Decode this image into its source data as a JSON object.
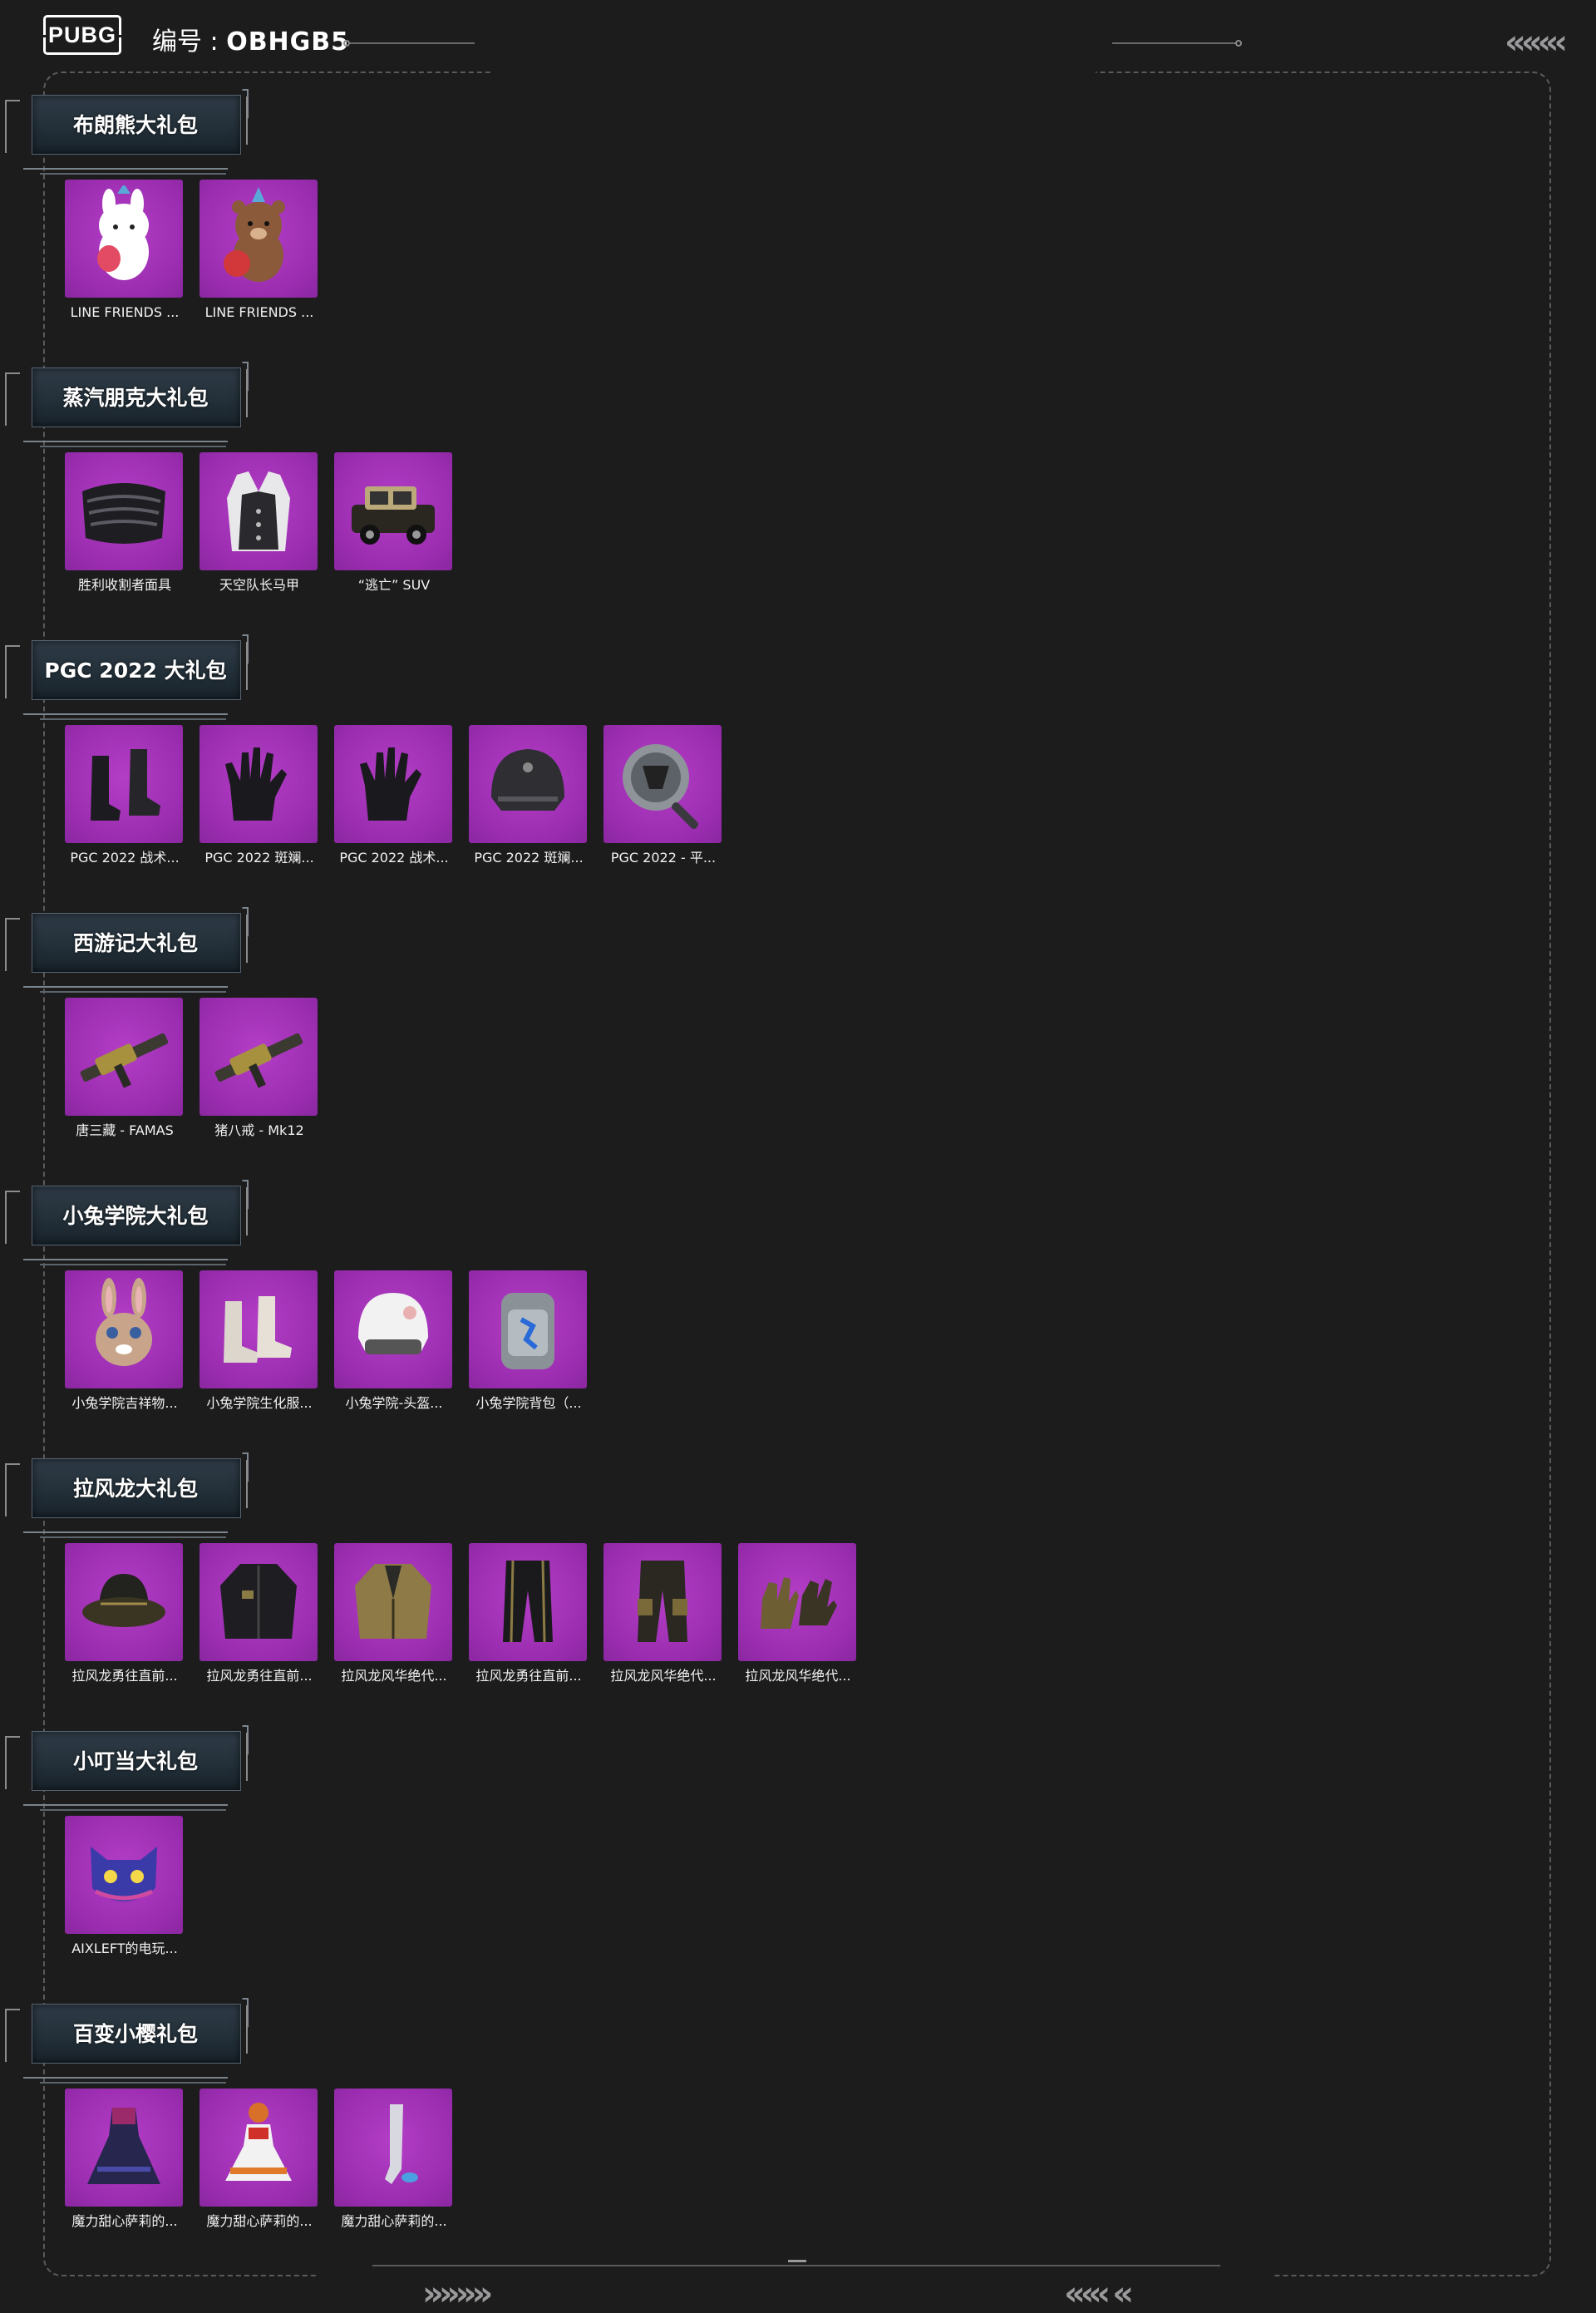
{
  "header": {
    "logo_text": "PUBG",
    "serial_label": "编号 : ",
    "serial_value": "OBHGB5"
  },
  "decor": {
    "top_right_chevrons": "«««‹",
    "bottom_left_chevrons": "»»»»",
    "bottom_right_chevrons": "««‹ «"
  },
  "sections": [
    {
      "title": "布朗熊大礼包",
      "items": [
        {
          "caption": "LINE FRIENDS ...",
          "icon": "cony-bunny-icon"
        },
        {
          "caption": "LINE FRIENDS ...",
          "icon": "brown-bear-icon"
        }
      ]
    },
    {
      "title": "蒸汽朋克大礼包",
      "items": [
        {
          "caption": "胜利收割者面具",
          "icon": "mask-icon"
        },
        {
          "caption": "天空队长马甲",
          "icon": "vest-icon"
        },
        {
          "caption": "“逃亡” SUV",
          "icon": "car-icon"
        }
      ]
    },
    {
      "title": "PGC 2022 大礼包",
      "items": [
        {
          "caption": "PGC 2022 战术...",
          "icon": "boots-icon"
        },
        {
          "caption": "PGC 2022 斑斓...",
          "icon": "glove-icon"
        },
        {
          "caption": "PGC 2022 战术...",
          "icon": "glove-icon"
        },
        {
          "caption": "PGC 2022 斑斓...",
          "icon": "helmet-icon"
        },
        {
          "caption": "PGC 2022 - 平...",
          "icon": "pan-icon"
        }
      ]
    },
    {
      "title": "西游记大礼包",
      "items": [
        {
          "caption": "唐三藏 - FAMAS",
          "icon": "rifle-icon"
        },
        {
          "caption": "猪八戒 - Mk12",
          "icon": "rifle-icon"
        }
      ]
    },
    {
      "title": "小兔学院大礼包",
      "items": [
        {
          "caption": "小兔学院吉祥物...",
          "icon": "rabbit-mascot-icon"
        },
        {
          "caption": "小兔学院生化服...",
          "icon": "shoes-icon"
        },
        {
          "caption": "小兔学院-头盔...",
          "icon": "white-helmet-icon"
        },
        {
          "caption": "小兔学院背包（...",
          "icon": "backpack-icon"
        }
      ]
    },
    {
      "title": "拉风龙大礼包",
      "items": [
        {
          "caption": "拉风龙勇往直前...",
          "icon": "bucket-hat-icon"
        },
        {
          "caption": "拉风龙勇往直前...",
          "icon": "jacket-icon"
        },
        {
          "caption": "拉风龙风华绝代...",
          "icon": "gold-jacket-icon"
        },
        {
          "caption": "拉风龙勇往直前...",
          "icon": "pants-icon"
        },
        {
          "caption": "拉风龙风华绝代...",
          "icon": "cargo-pants-icon"
        },
        {
          "caption": "拉风龙风华绝代...",
          "icon": "gold-gloves-icon"
        }
      ]
    },
    {
      "title": "小叮当大礼包",
      "items": [
        {
          "caption": "AIXLEFT的电玩...",
          "icon": "cat-mascot-icon"
        }
      ]
    },
    {
      "title": "百变小樱礼包",
      "items": [
        {
          "caption": "魔力甜心萨莉的...",
          "icon": "dress-icon"
        },
        {
          "caption": "魔力甜心萨莉的...",
          "icon": "orange-dress-icon"
        },
        {
          "caption": "魔力甜心萨莉的...",
          "icon": "stocking-icon"
        }
      ]
    }
  ]
}
